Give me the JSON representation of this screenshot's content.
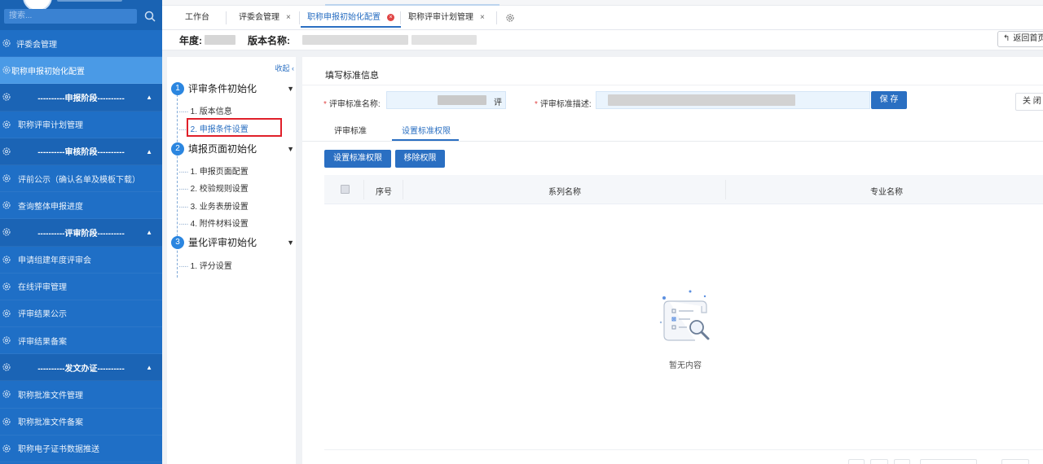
{
  "sidebar": {
    "search_placeholder": "搜索...",
    "items": [
      {
        "label": "评委会管理",
        "kind": "item"
      },
      {
        "label": "职称申报初始化配置",
        "kind": "active"
      },
      {
        "label": "----------申报阶段----------",
        "kind": "section"
      },
      {
        "label": "职称评审计划管理",
        "kind": "sub"
      },
      {
        "label": "----------审核阶段----------",
        "kind": "section"
      },
      {
        "label": "评前公示（确认名单及模板下载）",
        "kind": "sub"
      },
      {
        "label": "查询整体申报进度",
        "kind": "sub"
      },
      {
        "label": "----------评审阶段----------",
        "kind": "section"
      },
      {
        "label": "申请组建年度评审会",
        "kind": "sub"
      },
      {
        "label": "在线评审管理",
        "kind": "sub"
      },
      {
        "label": "评审结果公示",
        "kind": "sub"
      },
      {
        "label": "评审结果备案",
        "kind": "sub"
      },
      {
        "label": "----------发文办证----------",
        "kind": "section"
      },
      {
        "label": "职称批准文件管理",
        "kind": "sub"
      },
      {
        "label": "职称批准文件备案",
        "kind": "sub"
      },
      {
        "label": "职称电子证书数据推送",
        "kind": "sub"
      }
    ]
  },
  "tabs": {
    "t0": "工作台",
    "t1": "评委会管理",
    "t2": "职称申报初始化配置",
    "t3": "职称评审计划管理",
    "close": "×"
  },
  "infobar": {
    "year_label": "年度:",
    "version_label": "版本名称:",
    "back_label": "返回首页"
  },
  "tree": {
    "collapse": "收起",
    "steps": [
      {
        "num": "1",
        "label": "评审条件初始化"
      },
      {
        "num": "2",
        "label": "填报页面初始化"
      },
      {
        "num": "3",
        "label": "量化评审初始化"
      }
    ],
    "subs": {
      "s1a": "1. 版本信息",
      "s1b": "2. 申报条件设置",
      "s2a": "1. 申报页面配置",
      "s2b": "2. 校验规则设置",
      "s2c": "3. 业务表册设置",
      "s2d": "4. 附件材料设置",
      "s3a": "1. 评分设置"
    }
  },
  "main": {
    "title": "填写标准信息",
    "name_label": "评审标准名称:",
    "name_suffix": "评",
    "desc_label": "评审标准描述:",
    "save_label": "保 存",
    "close_label": "关 闭",
    "subtabs": [
      "评审标准",
      "设置标准权限"
    ],
    "set_perm_label": "设置标准权限",
    "remove_perm_label": "移除权限",
    "columns": [
      "序号",
      "系列名称",
      "专业名称"
    ],
    "empty_text": "暂无内容"
  }
}
